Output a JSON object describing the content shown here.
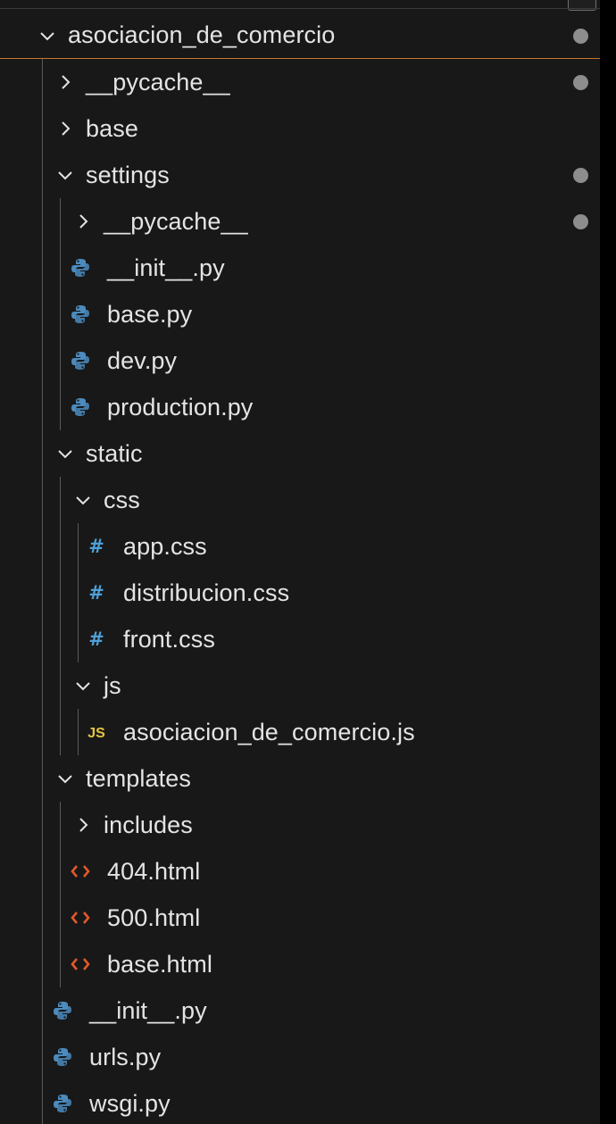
{
  "colors": {
    "background": "#181818",
    "text": "#e4e4e4",
    "root_underline": "#c5762d",
    "modified_dot": "#8d8d8d",
    "python_icon": "#4b8bbe",
    "css_icon": "#4f9fd8",
    "js_icon": "#e8c441",
    "html_icon": "#e2582b"
  },
  "tree": [
    {
      "label": "asociacion_de_comercio",
      "kind": "folder",
      "expanded": true,
      "depth": 0,
      "modified": true,
      "icon": "chevron-down-icon"
    },
    {
      "label": "__pycache__",
      "kind": "folder",
      "expanded": false,
      "depth": 1,
      "modified": true,
      "icon": "chevron-right-icon"
    },
    {
      "label": "base",
      "kind": "folder",
      "expanded": false,
      "depth": 1,
      "modified": false,
      "icon": "chevron-right-icon"
    },
    {
      "label": "settings",
      "kind": "folder",
      "expanded": true,
      "depth": 1,
      "modified": true,
      "icon": "chevron-down-icon"
    },
    {
      "label": "__pycache__",
      "kind": "folder",
      "expanded": false,
      "depth": 2,
      "modified": true,
      "icon": "chevron-right-icon"
    },
    {
      "label": "__init__.py",
      "kind": "python",
      "depth": 2,
      "modified": false,
      "icon": "python-file-icon"
    },
    {
      "label": "base.py",
      "kind": "python",
      "depth": 2,
      "modified": false,
      "icon": "python-file-icon"
    },
    {
      "label": "dev.py",
      "kind": "python",
      "depth": 2,
      "modified": false,
      "icon": "python-file-icon"
    },
    {
      "label": "production.py",
      "kind": "python",
      "depth": 2,
      "modified": false,
      "icon": "python-file-icon"
    },
    {
      "label": "static",
      "kind": "folder",
      "expanded": true,
      "depth": 1,
      "modified": false,
      "icon": "chevron-down-icon"
    },
    {
      "label": "css",
      "kind": "folder",
      "expanded": true,
      "depth": 2,
      "modified": false,
      "icon": "chevron-down-icon"
    },
    {
      "label": "app.css",
      "kind": "css",
      "depth": 3,
      "modified": false,
      "icon": "css-file-icon"
    },
    {
      "label": "distribucion.css",
      "kind": "css",
      "depth": 3,
      "modified": false,
      "icon": "css-file-icon"
    },
    {
      "label": "front.css",
      "kind": "css",
      "depth": 3,
      "modified": false,
      "icon": "css-file-icon"
    },
    {
      "label": "js",
      "kind": "folder",
      "expanded": true,
      "depth": 2,
      "modified": false,
      "icon": "chevron-down-icon"
    },
    {
      "label": "asociacion_de_comercio.js",
      "kind": "js",
      "depth": 3,
      "modified": false,
      "icon": "js-file-icon"
    },
    {
      "label": "templates",
      "kind": "folder",
      "expanded": true,
      "depth": 1,
      "modified": false,
      "icon": "chevron-down-icon"
    },
    {
      "label": "includes",
      "kind": "folder",
      "expanded": false,
      "depth": 2,
      "modified": false,
      "icon": "chevron-right-icon"
    },
    {
      "label": "404.html",
      "kind": "html",
      "depth": 2,
      "modified": false,
      "icon": "html-file-icon"
    },
    {
      "label": "500.html",
      "kind": "html",
      "depth": 2,
      "modified": false,
      "icon": "html-file-icon"
    },
    {
      "label": "base.html",
      "kind": "html",
      "depth": 2,
      "modified": false,
      "icon": "html-file-icon"
    },
    {
      "label": "__init__.py",
      "kind": "python",
      "depth": 1,
      "modified": false,
      "icon": "python-file-icon"
    },
    {
      "label": "urls.py",
      "kind": "python",
      "depth": 1,
      "modified": false,
      "icon": "python-file-icon"
    },
    {
      "label": "wsgi.py",
      "kind": "python",
      "depth": 1,
      "modified": false,
      "icon": "python-file-icon"
    }
  ]
}
